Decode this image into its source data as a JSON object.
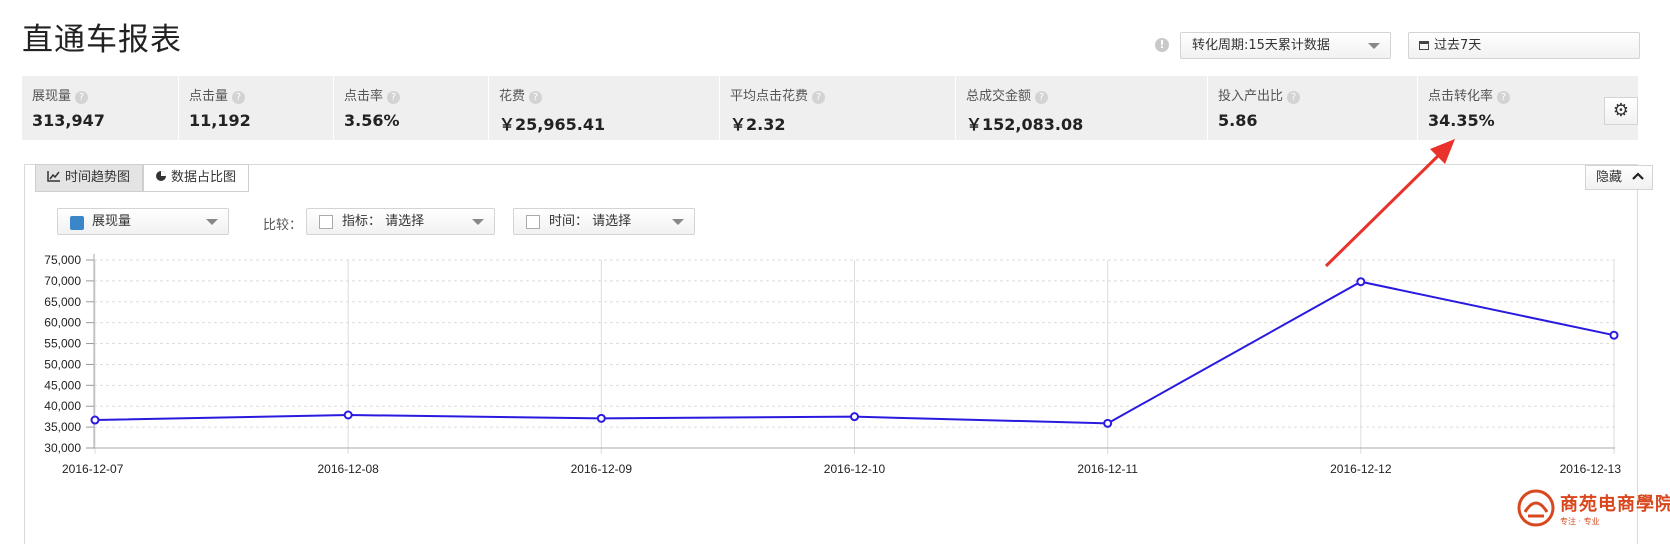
{
  "header": {
    "title": "直通车报表",
    "info_icon": "info-icon",
    "period_select": "转化周期:15天累计数据",
    "date_range": "过去7天"
  },
  "metrics": [
    {
      "label": "展现量",
      "value": "313,947"
    },
    {
      "label": "点击量",
      "value": "11,192"
    },
    {
      "label": "点击率",
      "value": "3.56%"
    },
    {
      "label": "花费",
      "value": "￥25,965.41"
    },
    {
      "label": "平均点击花费",
      "value": "￥2.32"
    },
    {
      "label": "总成交金额",
      "value": "￥152,083.08"
    },
    {
      "label": "投入产出比",
      "value": "5.86"
    },
    {
      "label": "点击转化率",
      "value": "34.35%"
    }
  ],
  "help_glyph": "?",
  "tabs": [
    {
      "label": "时间趋势图"
    },
    {
      "label": "数据占比图"
    }
  ],
  "hide_button": "隐藏",
  "controls": {
    "metric_selected": "展现量",
    "compare_label": "比较：",
    "indicator_select": "指标： 请选择",
    "time_select": "时间： 请选择"
  },
  "colors": {
    "line": "#2a1adf",
    "arrow": "#e8322b",
    "swatch": "#3a86c8",
    "brand": "#d9471e"
  },
  "chart_data": {
    "type": "line",
    "x": [
      "2016-12-07",
      "2016-12-08",
      "2016-12-09",
      "2016-12-10",
      "2016-12-11",
      "2016-12-12",
      "2016-12-13"
    ],
    "series": [
      {
        "values": [
          36700,
          37900,
          37100,
          37500,
          35900,
          69800,
          57000
        ]
      }
    ],
    "ylim": [
      30000,
      75000
    ],
    "yticks": [
      30000,
      35000,
      40000,
      45000,
      50000,
      55000,
      60000,
      65000,
      70000,
      75000
    ],
    "ytick_labels": [
      "30,000",
      "35,000",
      "40,000",
      "45,000",
      "50,000",
      "55,000",
      "60,000",
      "65,000",
      "70,000",
      "75,000"
    ],
    "grid": true
  },
  "logo": {
    "text": "商苑电商學院",
    "sub": "专注 · 专业"
  }
}
